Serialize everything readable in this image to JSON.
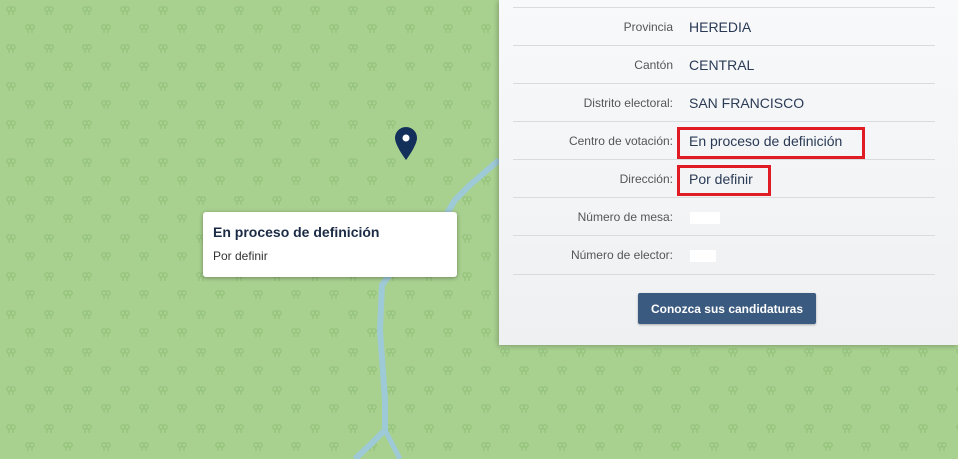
{
  "map": {
    "popup": {
      "title": "En proceso de definición",
      "subtitle": "Por definir"
    }
  },
  "panel": {
    "rows": [
      {
        "label": "Provincia",
        "value": "HEREDIA"
      },
      {
        "label": "Cantón",
        "value": "CENTRAL"
      },
      {
        "label": "Distrito electoral:",
        "value": "SAN FRANCISCO"
      },
      {
        "label": "Centro de votación:",
        "value": "En proceso de definición"
      },
      {
        "label": "Dirección:",
        "value": "Por definir"
      },
      {
        "label": "Número de mesa:",
        "value": ""
      },
      {
        "label": "Número de elector:",
        "value": ""
      }
    ],
    "button_label": "Conozca sus candidaturas"
  },
  "colors": {
    "map_background": "#a8d08f",
    "river": "#9ec9d6",
    "pin": "#12305a",
    "highlight": "#e01b24",
    "button": "#3b5a80"
  }
}
